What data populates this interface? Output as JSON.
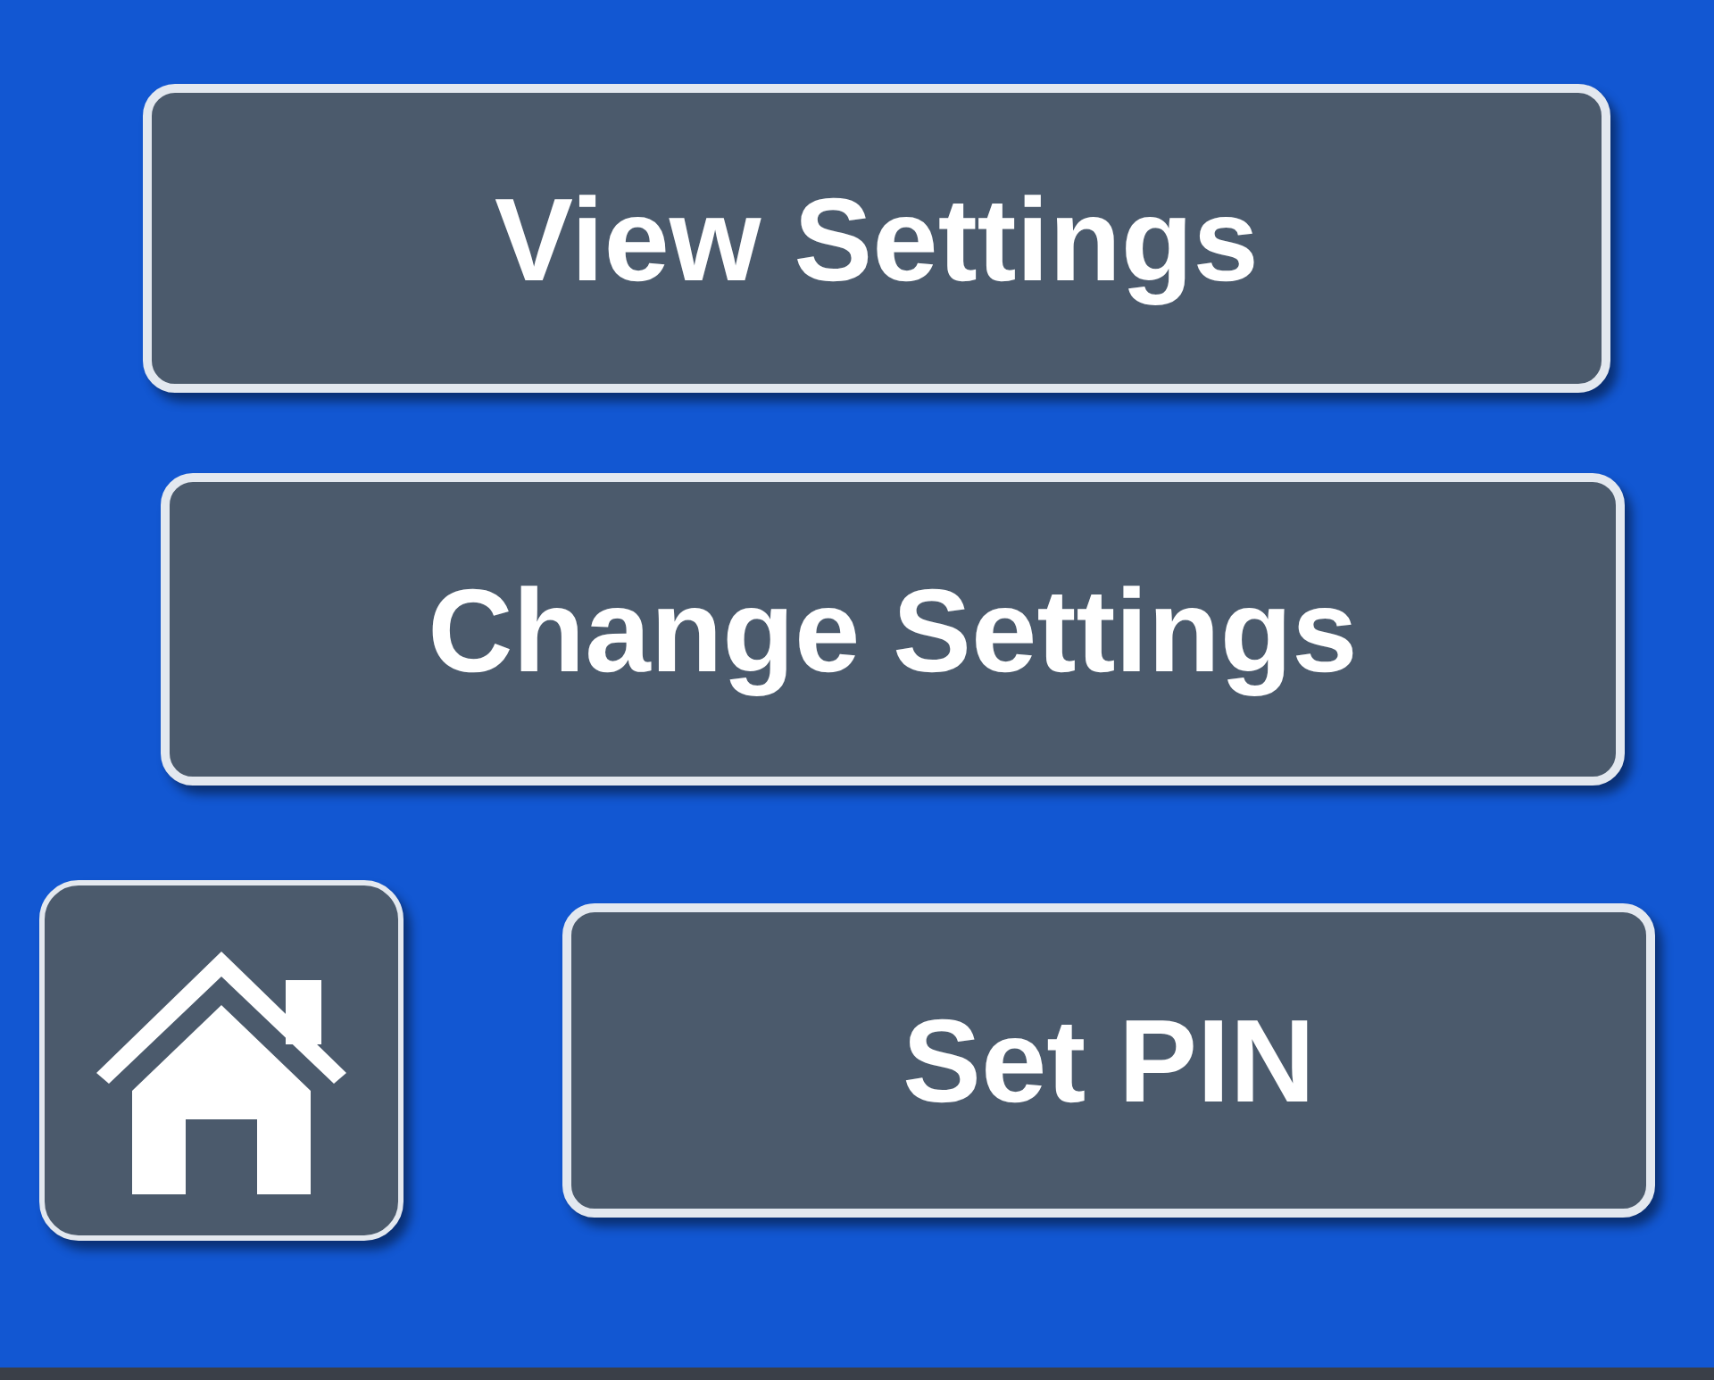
{
  "buttons": [
    {
      "kind": "text",
      "label": "View Settings"
    },
    {
      "kind": "text",
      "label": "Change Settings"
    },
    {
      "kind": "home"
    },
    {
      "kind": "text",
      "label": "Set PIN"
    }
  ]
}
